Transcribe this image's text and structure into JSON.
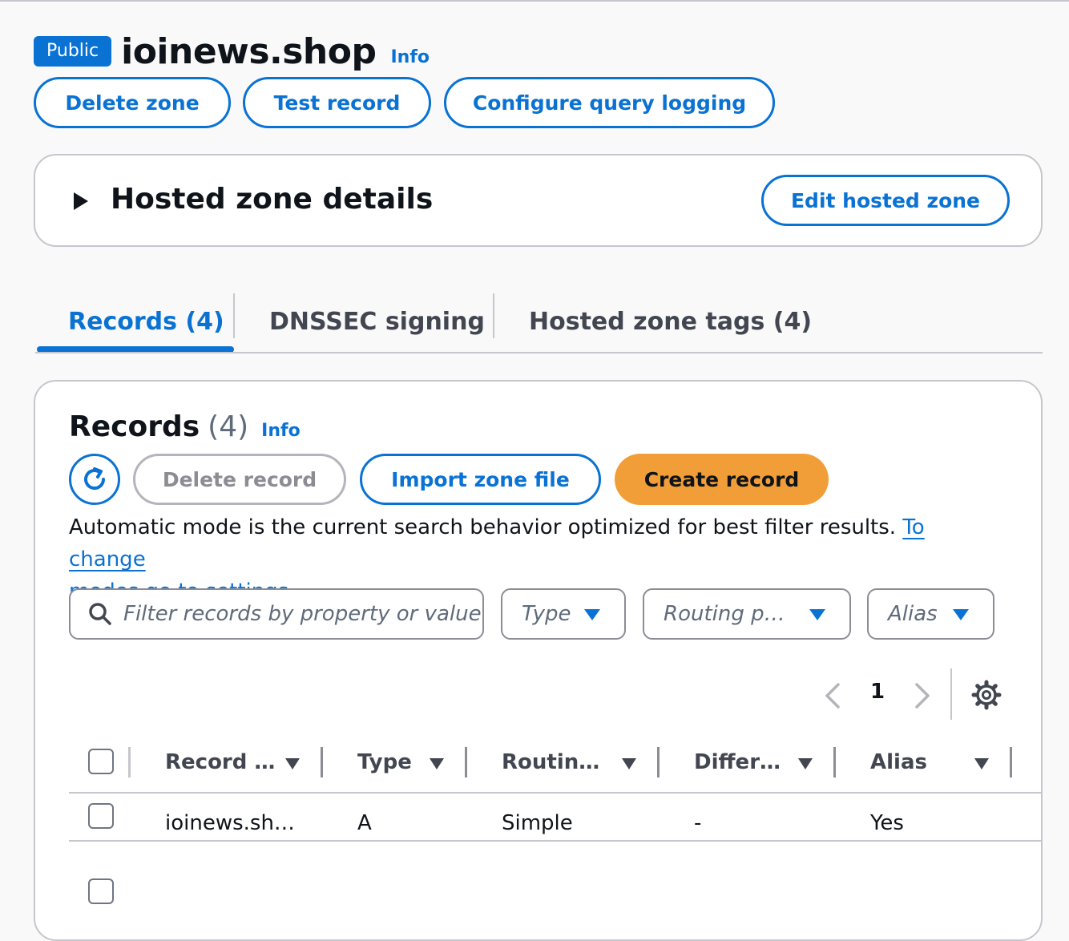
{
  "header": {
    "badge": "Public",
    "title": "ioinews.shop",
    "info": "Info"
  },
  "actions": {
    "delete_zone": "Delete zone",
    "test_record": "Test record",
    "configure_query_logging": "Configure query logging"
  },
  "details": {
    "title": "Hosted zone details",
    "edit_button": "Edit hosted zone"
  },
  "tabs": [
    {
      "label": "Records (4)"
    },
    {
      "label": "DNSSEC signing"
    },
    {
      "label": "Hosted zone tags (4)"
    }
  ],
  "records": {
    "heading": "Records",
    "count": "(4)",
    "info": "Info",
    "delete_record": "Delete record",
    "import_zone_file": "Import zone file",
    "create_record": "Create record",
    "mode_text": "Automatic mode is the current search behavior optimized for best filter results. ",
    "mode_link_1": "To change",
    "mode_link_2": "modes go to settings.",
    "filter_placeholder": "Filter records by property or value",
    "filters": {
      "type": "Type",
      "routing": "Routing p…",
      "alias": "Alias"
    },
    "page": "1",
    "columns": [
      "Record …",
      "Type",
      "Routin…",
      "Differ…",
      "Alias"
    ],
    "rows": [
      {
        "record": "ioinews.sh…",
        "type": "A",
        "routing": "Simple",
        "differ": "-",
        "alias": "Yes"
      }
    ]
  },
  "colors": {
    "accent": "#0972d3",
    "primary_button": "#f29e38"
  }
}
